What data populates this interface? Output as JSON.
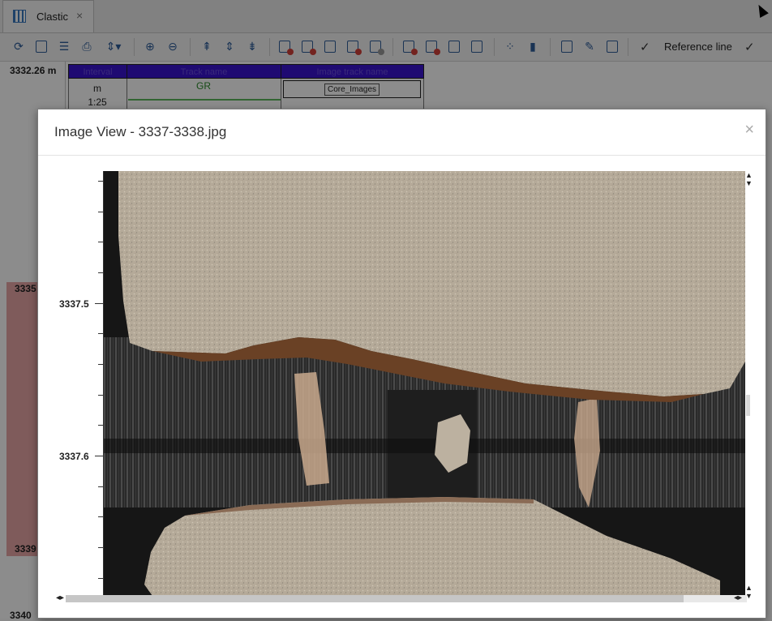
{
  "window": {
    "tab_label": "Clastic",
    "tab_close": "×"
  },
  "toolbar": {
    "icons": [
      "refresh-icon",
      "duplicate-icon",
      "list-icon",
      "print-icon",
      "fit-height-icon",
      "zoom-in-icon",
      "zoom-out-icon",
      "track-add-icon",
      "track-resize-icon",
      "track-remove-icon",
      "curve-add-icon",
      "curve-remove-icon",
      "curve-settings-icon",
      "interval-add-icon",
      "interval-remove-icon",
      "text-add-icon",
      "image-add-icon",
      "image-settings-icon",
      "image-remove-icon",
      "scatter-icon",
      "bar-icon",
      "panel-icon",
      "edit-icon",
      "export-icon"
    ],
    "reference_check": "✓",
    "reference_label": "Reference line",
    "second_check": "✓"
  },
  "log": {
    "top_depth": "3332.26 m",
    "depth_label_1": "3335",
    "depth_label_2": "3339",
    "depth_label_3": "3340",
    "tracks": [
      {
        "header": "Interval",
        "unit": "m",
        "scale": "1:25"
      },
      {
        "header": "Track name",
        "curve": "GR"
      },
      {
        "header": "Image track name",
        "image_set": "Core_Images"
      }
    ]
  },
  "modal": {
    "title": "Image View - 3337-3338.jpg",
    "close": "×",
    "depth_ticks": [
      "3337.5",
      "3337.6"
    ]
  },
  "colors": {
    "track_header": "#3a13d0",
    "depth_band": "#e7a6a6",
    "curve_line": "#5cb85c"
  }
}
